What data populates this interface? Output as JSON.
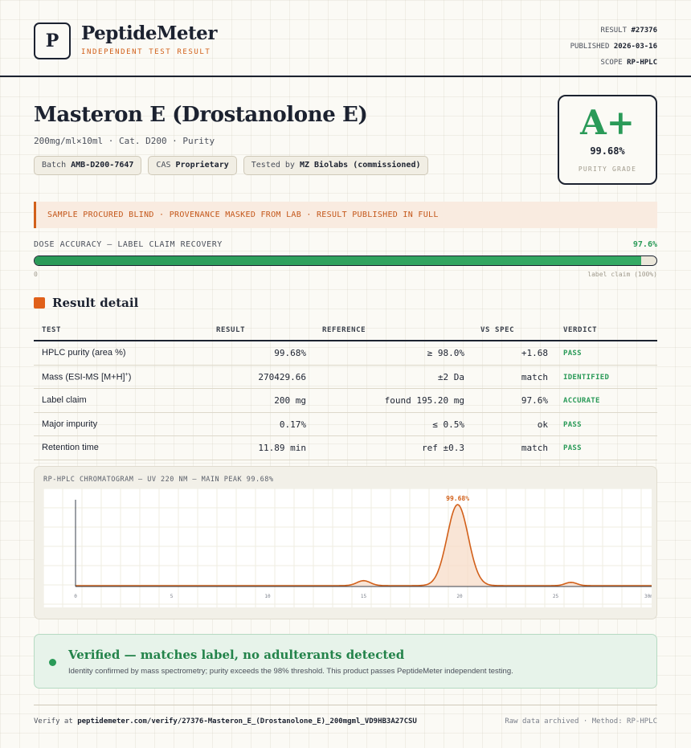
{
  "header": {
    "logo_letter": "P",
    "brand": "PeptideMeter",
    "brand_sub": "INDEPENDENT TEST RESULT",
    "meta": [
      {
        "label": "RESULT",
        "value": "#27376"
      },
      {
        "label": "PUBLISHED",
        "value": "2026-03-16"
      },
      {
        "label": "SCOPE",
        "value": "RP-HPLC"
      }
    ]
  },
  "product": {
    "title": "Masteron E (Drostanolone E)",
    "subtitle": "200mg/ml×10ml · Cat. D200 · Purity",
    "chips": [
      {
        "label": "Batch",
        "value": "AMB-D200-7647"
      },
      {
        "label": "CAS",
        "value": "Proprietary"
      },
      {
        "label": "Tested by",
        "value": "MZ Biolabs (commissioned)"
      }
    ]
  },
  "grade": {
    "letter": "A+",
    "purity": "99.68%",
    "label": "PURITY GRADE",
    "color": "#2a9a58"
  },
  "banner": {
    "text": "SAMPLE PROCURED BLIND · PROVENANCE MASKED FROM LAB · RESULT PUBLISHED IN FULL"
  },
  "dose": {
    "label": "DOSE ACCURACY — LABEL CLAIM RECOVERY",
    "value_text": "97.6%",
    "fill_percent": 97.6,
    "min_label": "0",
    "max_label": "label claim (100%)"
  },
  "section": {
    "title": "Result detail"
  },
  "table": {
    "headers": {
      "test": "TEST",
      "result": "RESULT",
      "reference": "REFERENCE",
      "vs_spec": "VS SPEC",
      "verdict": "VERDICT"
    },
    "rows": [
      {
        "test": "HPLC purity (area %)",
        "result": "99.68%",
        "reference": "≥ 98.0%",
        "vs_spec": "+1.68",
        "verdict": "PASS"
      },
      {
        "test": "Mass (ESI-MS [M+H]",
        "test_sup": "+",
        "test_suffix": ")",
        "result": "270429.66",
        "reference": "±2 Da",
        "vs_spec": "match",
        "verdict": "IDENTIFIED"
      },
      {
        "test": "Label claim",
        "result": "200 mg",
        "reference": "found 195.20 mg",
        "vs_spec": "97.6%",
        "verdict": "ACCURATE"
      },
      {
        "test": "Major impurity",
        "result": "0.17%",
        "reference": "≤ 0.5%",
        "vs_spec": "ok",
        "verdict": "PASS"
      },
      {
        "test": "Retention time",
        "result": "11.89 min",
        "reference": "ref ±0.3",
        "vs_spec": "match",
        "verdict": "PASS"
      }
    ]
  },
  "chart_data": {
    "type": "line",
    "title": "RP-HPLC CHROMATOGRAM — UV 220 NM — MAIN PEAK 99.68%",
    "xlim": [
      0,
      30
    ],
    "x_ticks": [
      "0",
      "5",
      "10",
      "15",
      "20",
      "25",
      "30"
    ],
    "x_tick_last_suffix": "min",
    "peaks": [
      {
        "rt": 15.0,
        "height": 0.06,
        "width": 0.35
      },
      {
        "rt": 19.9,
        "height": 0.97,
        "width": 0.55,
        "label": "99.68%"
      },
      {
        "rt": 25.8,
        "height": 0.04,
        "width": 0.3
      }
    ],
    "baseline": 0.01,
    "line_color": "#d2601a",
    "fill_color": "#f7dcc8"
  },
  "verified": {
    "title": "Verified — matches label, no adulterants detected",
    "text": "Identity confirmed by mass spectrometry; purity exceeds the 98% threshold. This product passes PeptideMeter independent testing."
  },
  "footer": {
    "verify_prefix": "Verify at",
    "verify_url": "peptidemeter.com/verify/27376-Masteron_E_(Drostanolone_E)_200mgml_VD9HB3A27CSU",
    "right": "Raw data archived · Method: RP-HPLC"
  }
}
